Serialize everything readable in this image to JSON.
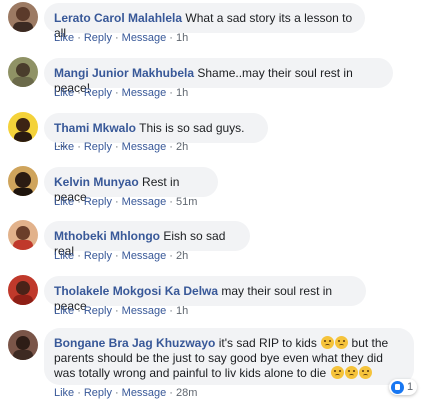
{
  "actions": {
    "like": "Like",
    "reply": "Reply",
    "message": "Message",
    "separator": "·"
  },
  "comments": [
    {
      "author": "Lerato Carol Malahlela",
      "text": "What a sad story its a lesson to all",
      "time": "1h"
    },
    {
      "author": "Mangi Junior Makhubela",
      "text": "Shame..may their soul rest in peace!",
      "time": "1h"
    },
    {
      "author": "Thami Mkwalo",
      "text": "This is so sad guys. .....",
      "time": "2h"
    },
    {
      "author": "Kelvin Munyao",
      "text": "Rest in peace",
      "time": "51m"
    },
    {
      "author": "Mthobeki Mhlongo",
      "text": "Eish so sad real",
      "time": "2h"
    },
    {
      "author": "Tholakele Mokgosi Ka Delwa",
      "text": "may their soul rest in peace",
      "time": "1h"
    },
    {
      "author": "Bongane Bra Jag Khuzwayo",
      "text_part1": "it's sad RIP to kids",
      "text_part2": "but the parents should be the just to say good bye even what they did was totally wrong and painful to liv kids alone to die",
      "time": "28m",
      "reaction_count": "1"
    }
  ],
  "icons": {
    "emoji": "crying-face-icon",
    "reaction": "like-reaction-icon"
  },
  "colors": {
    "author": "#385898",
    "bubble": "#f2f3f5",
    "meta": "#606770",
    "like_blue": "#1877f2"
  }
}
